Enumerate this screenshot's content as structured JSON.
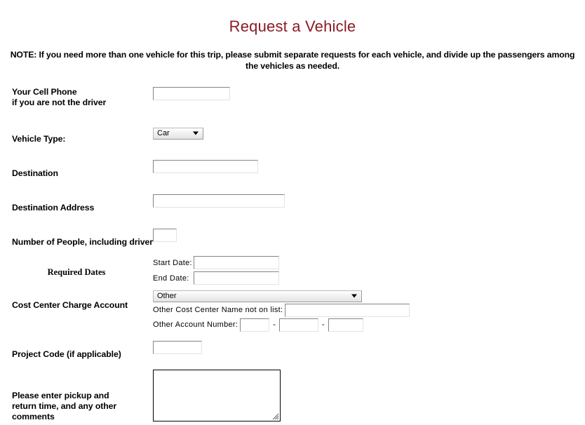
{
  "header": {
    "title": "Request a Vehicle",
    "note": "NOTE: If you need more than one vehicle for this trip, please submit separate requests for each vehicle, and divide up the passengers among the vehicles as needed.",
    "title_color": "#8b1a24"
  },
  "form": {
    "cell_phone": {
      "label_line1": "Your Cell Phone",
      "label_line2": "if you are not the driver",
      "value": "",
      "placeholder": ""
    },
    "vehicle_type": {
      "label": "Vehicle Type:",
      "selected": "Car",
      "options": [
        "Car"
      ]
    },
    "destination": {
      "label": "Destination",
      "value": "",
      "placeholder": ""
    },
    "destination_address": {
      "label": "Destination Address",
      "value": "",
      "placeholder": ""
    },
    "number_of_people": {
      "label": "Number of People, including driver",
      "value": "",
      "placeholder": ""
    },
    "required_dates": {
      "label": "Required Dates",
      "start_label": "Start Date:",
      "start_value": "",
      "end_label": "End Date:",
      "end_value": ""
    },
    "cost_center": {
      "label": "Cost Center Charge Account",
      "selected": "Other",
      "options": [
        "Other"
      ],
      "other_name_label": "Other Cost Center Name not on list:",
      "other_name_value": "",
      "other_account_label": "Other Account Number:",
      "account_part1": "",
      "account_part2": "",
      "account_part3": "",
      "separator": "-"
    },
    "project_code": {
      "label": "Project Code (if applicable)",
      "value": "",
      "placeholder": ""
    },
    "comments": {
      "label_line1": "Please enter pickup and",
      "label_line2": "return time, and any other comments",
      "value": "",
      "placeholder": ""
    }
  }
}
